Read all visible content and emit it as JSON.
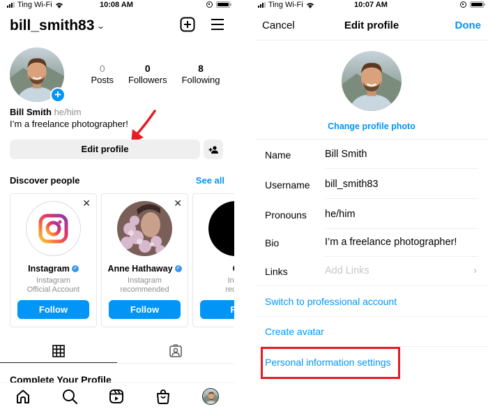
{
  "left_screen": {
    "status_bar": {
      "carrier": "Ting Wi-Fi",
      "time": "10:08 AM"
    },
    "header": {
      "username": "bill_smith83",
      "icons": [
        "chevron-down-icon",
        "new-post-icon",
        "menu-icon"
      ]
    },
    "profile": {
      "stats": [
        {
          "value": "0",
          "label": "Posts"
        },
        {
          "value": "0",
          "label": "Followers"
        },
        {
          "value": "8",
          "label": "Following"
        }
      ],
      "name": "Bill Smith",
      "pronouns": "he/him",
      "bio": "I’m a freelance photographer!",
      "edit_button": "Edit profile"
    },
    "discover": {
      "title": "Discover people",
      "see_all": "See all",
      "cards": [
        {
          "name": "Instagram",
          "verified": true,
          "line1": "Instagram",
          "line2": "Official Account",
          "button": "Follow"
        },
        {
          "name": "Anne Hathaway",
          "verified": true,
          "line1": "Instagram",
          "line2": "recommended",
          "button": "Follow"
        },
        {
          "name": "G",
          "verified": false,
          "line1": "Insta",
          "line2": "recom",
          "button": "Fo"
        }
      ]
    },
    "tabs": [
      "grid-icon",
      "tagged-icon"
    ],
    "complete_profile": "Complete Your Profile",
    "bottom_nav": [
      "home-icon",
      "search-icon",
      "reels-icon",
      "shop-icon",
      "profile-avatar"
    ],
    "annotation": {
      "color": "#e41c23",
      "points_to": "Edit profile"
    }
  },
  "right_screen": {
    "status_bar": {
      "carrier": "Ting Wi-Fi",
      "time": "10:07 AM"
    },
    "nav": {
      "cancel": "Cancel",
      "title": "Edit profile",
      "done": "Done"
    },
    "change_photo": "Change profile photo",
    "fields": [
      {
        "label": "Name",
        "value": "Bill Smith"
      },
      {
        "label": "Username",
        "value": "bill_smith83"
      },
      {
        "label": "Pronouns",
        "value": "he/him"
      },
      {
        "label": "Bio",
        "value": "I’m a freelance photographer!"
      },
      {
        "label": "Links",
        "placeholder": "Add Links"
      }
    ],
    "links": {
      "professional": "Switch to professional account",
      "avatar": "Create avatar",
      "personal_info": "Personal information settings"
    },
    "highlight": {
      "color": "#e41c23",
      "target": "Personal information settings"
    }
  },
  "colors": {
    "accent": "#0095f6",
    "highlight": "#e41c23",
    "muted": "#8e8e8e"
  }
}
